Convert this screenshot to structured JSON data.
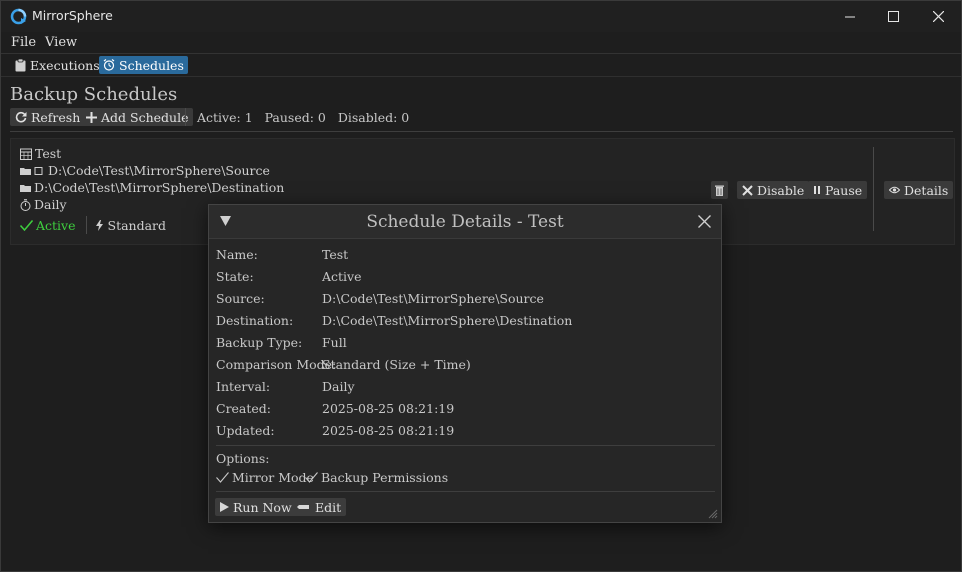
{
  "window": {
    "title": "MirrorSphere"
  },
  "menu": [
    "File",
    "View"
  ],
  "tabs": [
    {
      "label": "Executions",
      "icon": "clipboard-icon",
      "active": false
    },
    {
      "label": "Schedules",
      "icon": "alarm-clock-icon",
      "active": true
    }
  ],
  "page": {
    "title": "Backup Schedules"
  },
  "toolbar": {
    "refresh_label": "Refresh",
    "add_label": "Add Schedule"
  },
  "counts": {
    "active": "Active: 1",
    "paused": "Paused: 0",
    "disabled": "Disabled: 0"
  },
  "schedule": {
    "name": "Test",
    "source": "D:\\Code\\Test\\MirrorSphere\\Source",
    "destination": "D:\\Code\\Test\\MirrorSphere\\Destination",
    "interval": "Daily",
    "status": "Active",
    "mode": "Standard",
    "actions": {
      "disable": "Disable",
      "pause": "Pause",
      "details": "Details"
    }
  },
  "details": {
    "title": "Schedule Details - Test",
    "fields": [
      {
        "label": "Name:",
        "value": "Test"
      },
      {
        "label": "State:",
        "value": "Active"
      },
      {
        "label": "Source:",
        "value": "D:\\Code\\Test\\MirrorSphere\\Source"
      },
      {
        "label": "Destination:",
        "value": "D:\\Code\\Test\\MirrorSphere\\Destination"
      },
      {
        "label": "Backup Type:",
        "value": "Full"
      },
      {
        "label": "Comparison Mode:",
        "value": "Standard (Size + Time)"
      },
      {
        "label": "Interval:",
        "value": "Daily"
      },
      {
        "label": "Created:",
        "value": "2025-08-25 08:21:19"
      },
      {
        "label": "Updated:",
        "value": "2025-08-25 08:21:19"
      }
    ],
    "options_label": "Options:",
    "options": [
      "Mirror Mode",
      "Backup Permissions"
    ],
    "run_label": "Run Now",
    "edit_label": "Edit"
  },
  "colors": {
    "accent": "#2a6a9c",
    "active_status": "#3ecf3e",
    "background": "#1e1e1e"
  }
}
